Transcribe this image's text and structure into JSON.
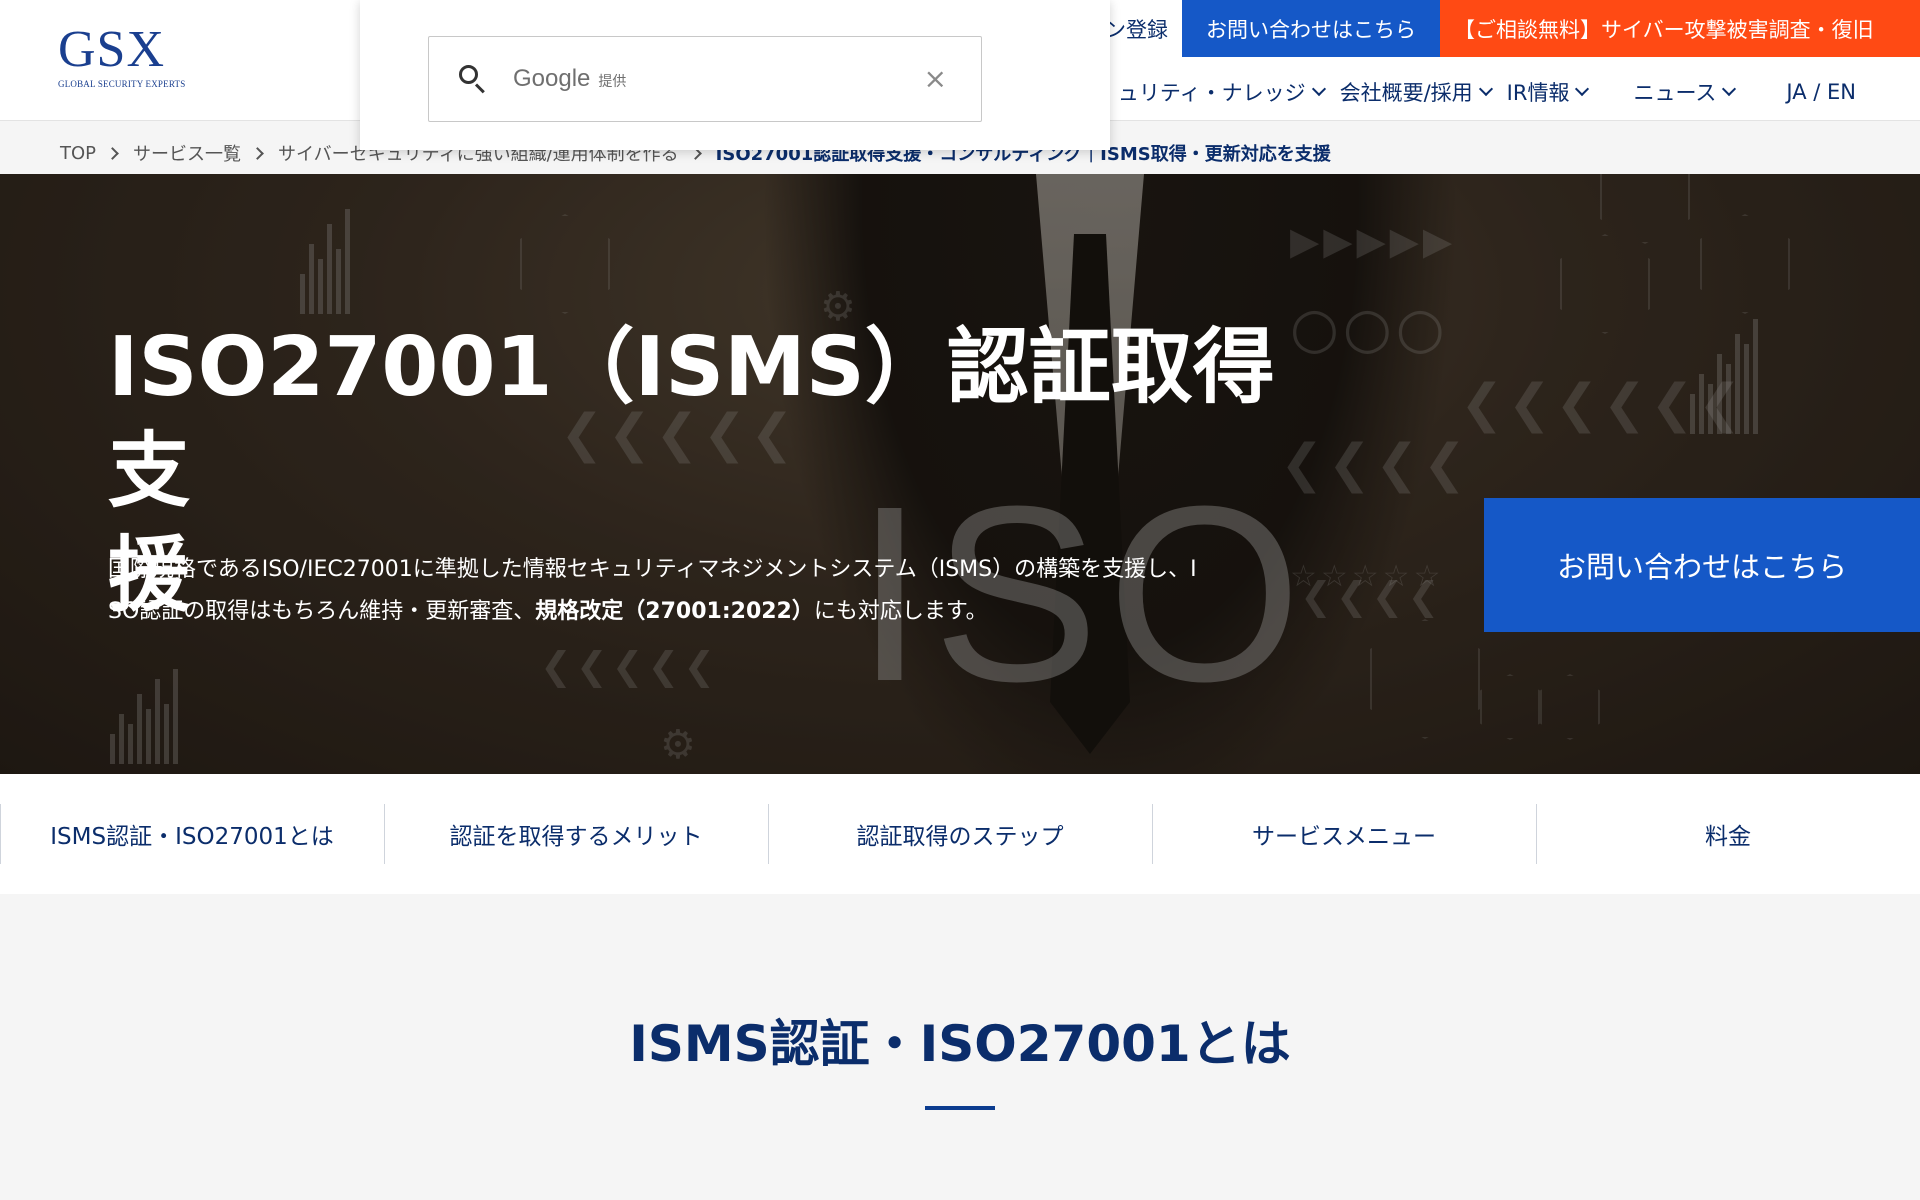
{
  "header": {
    "logo_text": "GSX",
    "logo_sub": "GLOBAL SECURITY EXPERTS",
    "top_links": {
      "register": "ン登録",
      "contact": "お問い合わせはこちら",
      "urgent": "【ご相談無料】サイバー攻撃被害調査・復旧"
    },
    "nav": [
      {
        "label": "ュリティ・ナレッジ"
      },
      {
        "label": "会社概要/採用"
      },
      {
        "label": "IR情報"
      },
      {
        "label": "ニュース"
      }
    ],
    "lang": "JA / EN"
  },
  "search": {
    "brand": "Google",
    "powered": "提供",
    "close": "×"
  },
  "breadcrumb": {
    "items": [
      "TOP",
      "サービス一覧",
      "サイバーセキュリティに強い組織/運用体制を作る"
    ],
    "current": "ISO27001認証取得支援・コンサルティング｜ISMS取得・更新対応を支援"
  },
  "hero": {
    "title_line1": "ISO27001（ISMS）認証取得支",
    "title_line2": "援",
    "desc_pre": "国際規格であるISO/IEC27001に準拠した情報セキュリティマネジメントシステム（ISMS）の構築を支援し、I",
    "desc_line2_pre": "SO認証の取得はもちろん維持・更新審査、",
    "desc_bold": "規格改定（27001:2022）",
    "desc_post": "にも対応します。",
    "bg_text": "ISO",
    "cta": "お問い合わせはこちら"
  },
  "tabs": [
    {
      "label": "ISMS認証・ISO27001とは"
    },
    {
      "label": "認証を取得するメリット"
    },
    {
      "label": "認証取得のステップ"
    },
    {
      "label": "サービスメニュー"
    },
    {
      "label": "料金"
    }
  ],
  "section": {
    "title": "ISMS認証・ISO27001とは"
  },
  "colors": {
    "brand_navy": "#0b2d6b",
    "cta_blue": "#1558c7",
    "urgent_orange": "#ff4a14"
  }
}
